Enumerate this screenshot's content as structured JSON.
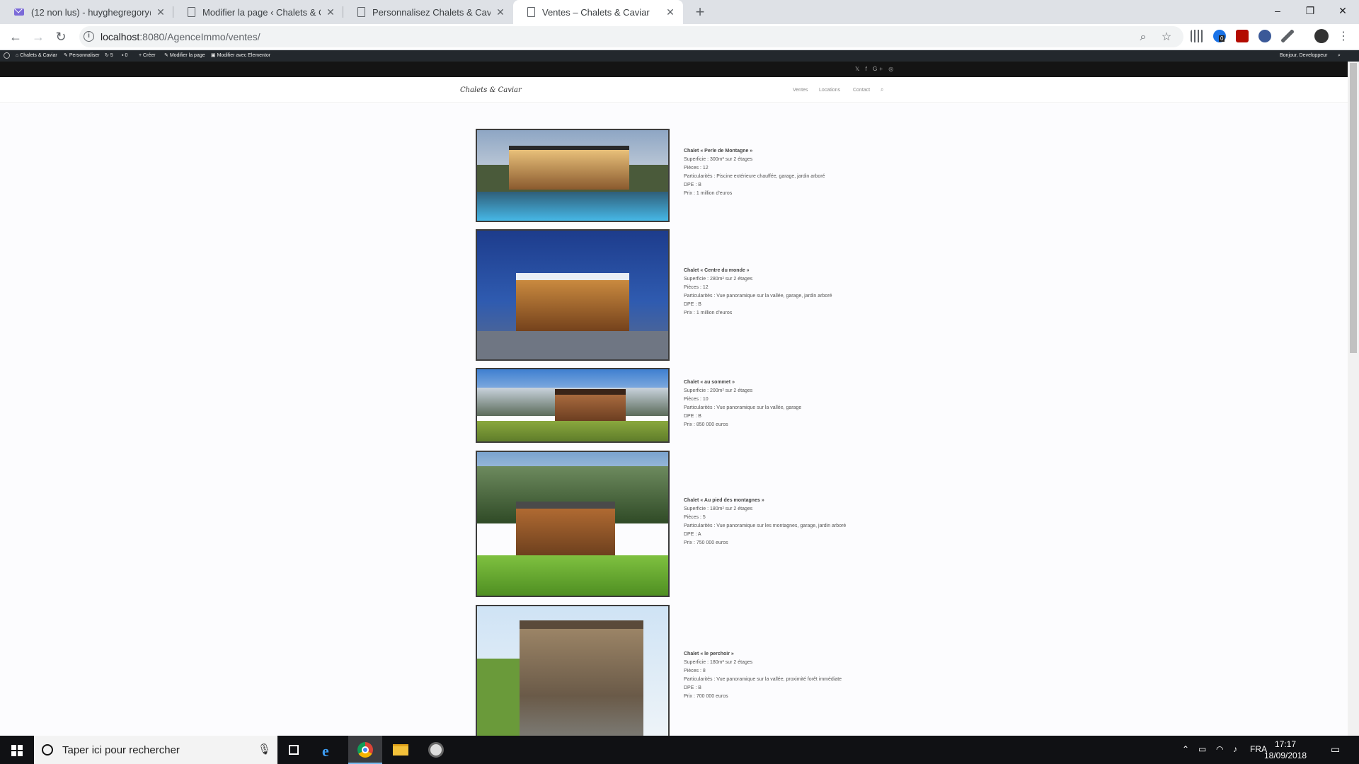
{
  "browser": {
    "tabs": [
      {
        "title": "(12 non lus) - huyghegregory@y",
        "icon": "mail-icon",
        "active": false
      },
      {
        "title": "Modifier la page ‹ Chalets & Cav",
        "icon": "document-icon",
        "active": false
      },
      {
        "title": "Personnalisez Chalets & Caviar –",
        "icon": "document-icon",
        "active": false
      },
      {
        "title": "Ventes – Chalets & Caviar",
        "icon": "document-icon",
        "active": true
      }
    ],
    "new_tab": "+",
    "window_controls": {
      "minimize": "–",
      "maximize": "❐",
      "close": "✕"
    },
    "nav": {
      "back": "←",
      "forward": "→",
      "reload": "↻"
    },
    "url_host": "localhost",
    "url_rest": ":8080/AgenceImmo/ventes/",
    "omnibox_icons": [
      "zoom-icon",
      "star-icon"
    ],
    "extension_badge": "0"
  },
  "admin_bar": {
    "site_name": "Chalets & Caviar",
    "customize": "Personnaliser",
    "updates": "5",
    "comments": "0",
    "new": "Créer",
    "edit_page": "Modifier la page",
    "elementor": "Modifier avec Elementor",
    "greeting": "Bonjour, Developpeur"
  },
  "site": {
    "logo": "Chalets & Caviar",
    "social": "𝕏 f G+ ◎",
    "menu": [
      "Ventes",
      "Locations",
      "Contact"
    ]
  },
  "listings": [
    {
      "title": "Chalet « Perle de Montagne »",
      "surface": "Superficie : 300m² sur 2 étages",
      "rooms": "Pièces : 12",
      "features": "Particularités : Piscine extérieure chauffée, garage, jardin arboré",
      "dpe": "DPE : B",
      "price": "Prix : 1 million d'euros"
    },
    {
      "title": "Chalet « Centre du monde »",
      "surface": "Superficie : 280m² sur 2 étages",
      "rooms": "Pièces : 12",
      "features": "Particularités : Vue panoramique sur la vallée, garage, jardin arboré",
      "dpe": "DPE : B",
      "price": "Prix : 1 million d'euros"
    },
    {
      "title": "Chalet « au sommet »",
      "surface": "Superficie : 200m² sur 2 étages",
      "rooms": "Pièces : 10",
      "features": "Particularités : Vue panoramique sur la vallée, garage",
      "dpe": "DPE : B",
      "price": "Prix : 850 000 euros"
    },
    {
      "title": "Chalet « Au pied des montagnes »",
      "surface": "Superficie : 180m² sur 2 étages",
      "rooms": "Pièces : 5",
      "features": "Particularités : Vue panoramique sur les montagnes, garage, jardin arboré",
      "dpe": "DPE : A",
      "price": "Prix : 750 000 euros"
    },
    {
      "title": "Chalet « le perchoir »",
      "surface": "Superficie : 180m² sur 2 étages",
      "rooms": "Pièces : 8",
      "features": "Particularités : Vue panoramique sur la vallée, proximité forêt immédiate",
      "dpe": "DPE : B",
      "price": "Prix : 700 000 euros"
    }
  ],
  "taskbar": {
    "search_placeholder": "Taper ici pour rechercher",
    "language": "FRA",
    "time": "17:17",
    "date": "18/09/2018"
  }
}
